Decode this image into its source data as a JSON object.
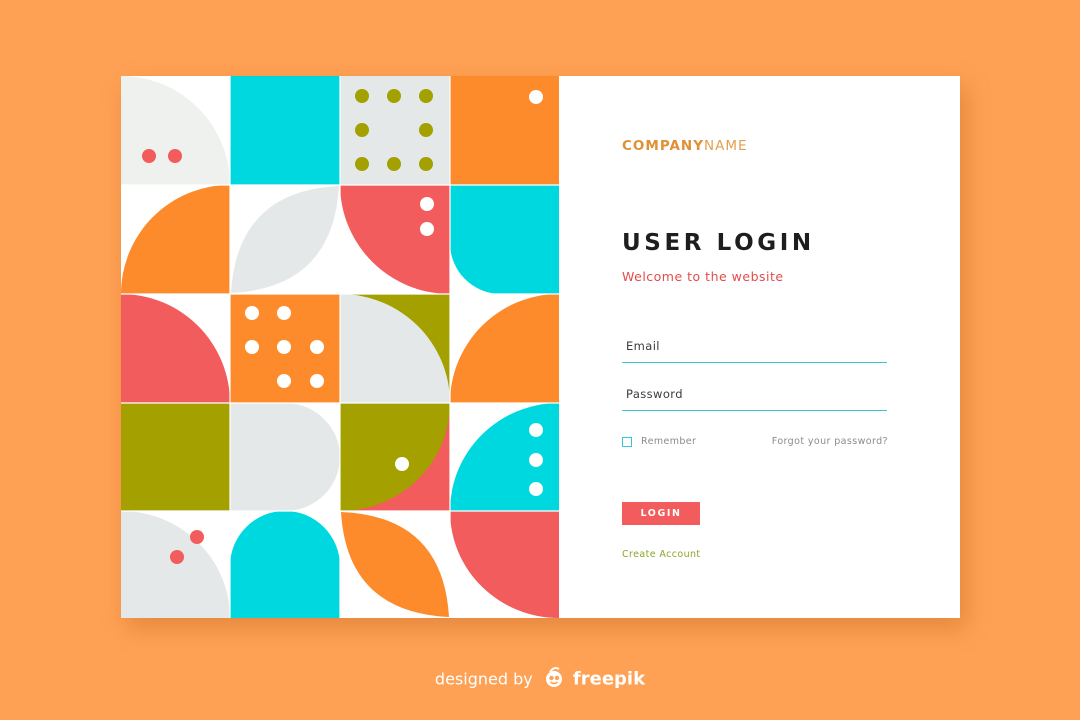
{
  "colors": {
    "background": "#ffa154",
    "cyan": "#00d8e0",
    "coral": "#f25c5c",
    "orange": "#fd8a2b",
    "olive": "#a3a000",
    "light_gray": "#e5e8e8",
    "accent_line": "#36c6d3",
    "link_green": "#8aa62a"
  },
  "brand": {
    "company_bold": "COMPANY",
    "company_light": "NAME"
  },
  "login": {
    "title": "USER LOGIN",
    "subtitle": "Welcome to the website",
    "email_placeholder": "Email",
    "password_placeholder": "Password",
    "remember_label": "Remember",
    "forgot_link": "Forgot your password?",
    "login_button": "LOGIN",
    "create_account": "Create Account"
  },
  "credit": {
    "designed_by": "designed by",
    "brand": "freepik",
    "logo_icon": "freepik-logo-icon"
  }
}
